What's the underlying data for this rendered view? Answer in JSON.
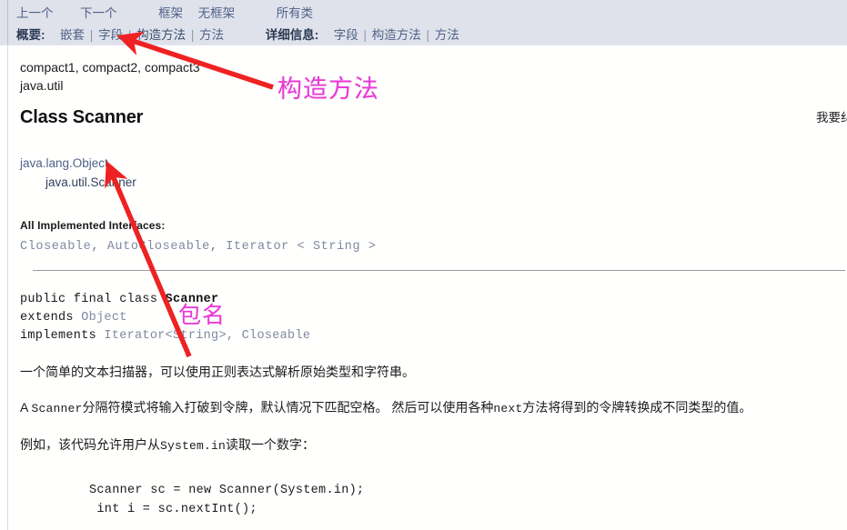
{
  "nav": {
    "top_row": [
      {
        "label": "上一个",
        "name": "nav-prev"
      },
      {
        "label": "下一个",
        "name": "nav-next"
      },
      {
        "label": "框架",
        "name": "nav-frames"
      },
      {
        "label": "无框架",
        "name": "nav-no-frames"
      },
      {
        "label": "所有类",
        "name": "nav-all-classes"
      }
    ],
    "summary_label": "概要:",
    "summary_links": [
      "嵌套",
      "字段",
      "构造方法",
      "方法"
    ],
    "detail_label": "详细信息:",
    "detail_links": [
      "字段",
      "构造方法",
      "方法"
    ],
    "separator": "|"
  },
  "header": {
    "profiles": "compact1, compact2, compact3",
    "package": "java.util",
    "class_title": "Class Scanner"
  },
  "inheritance": {
    "level0": "java.lang.Object",
    "level1": "java.util.Scanner"
  },
  "interfaces": {
    "label": "All Implemented Interfaces:",
    "items": [
      "Closeable",
      "AutoCloseable",
      "Iterator < String >"
    ],
    "comma": ","
  },
  "declaration": {
    "line1_kw": "public final class ",
    "line1_class": "Scanner",
    "line2_kw": "extends ",
    "line2_type": "Object",
    "line3_kw": "implements ",
    "line3_type": "Iterator<String>, Closeable"
  },
  "description": {
    "p1": "一个简单的文本扫描器，可以使用正则表达式解析原始类型和字符串。",
    "p2_a": "A ",
    "p2_mono": "Scanner",
    "p2_b": "分隔符模式将输入打破到令牌，默认情况下匹配空格。 然后可以使用各种",
    "p2_mono2": "next",
    "p2_c": "方法将得到的令牌转换成不同类型的值。",
    "p3_a": "例如，该代码允许用户从",
    "p3_mono": "System.in",
    "p3_b": "读取一个数字：",
    "code_line1": "Scanner sc = new Scanner(System.in);",
    "code_line2": " int i = sc.nextInt();"
  },
  "feedback": {
    "label": "我要纠错"
  },
  "annotations": {
    "label_constructor": "构造方法",
    "label_package": "包名",
    "arrow_color": "#ee2222",
    "text_color": "#e83ad6"
  }
}
